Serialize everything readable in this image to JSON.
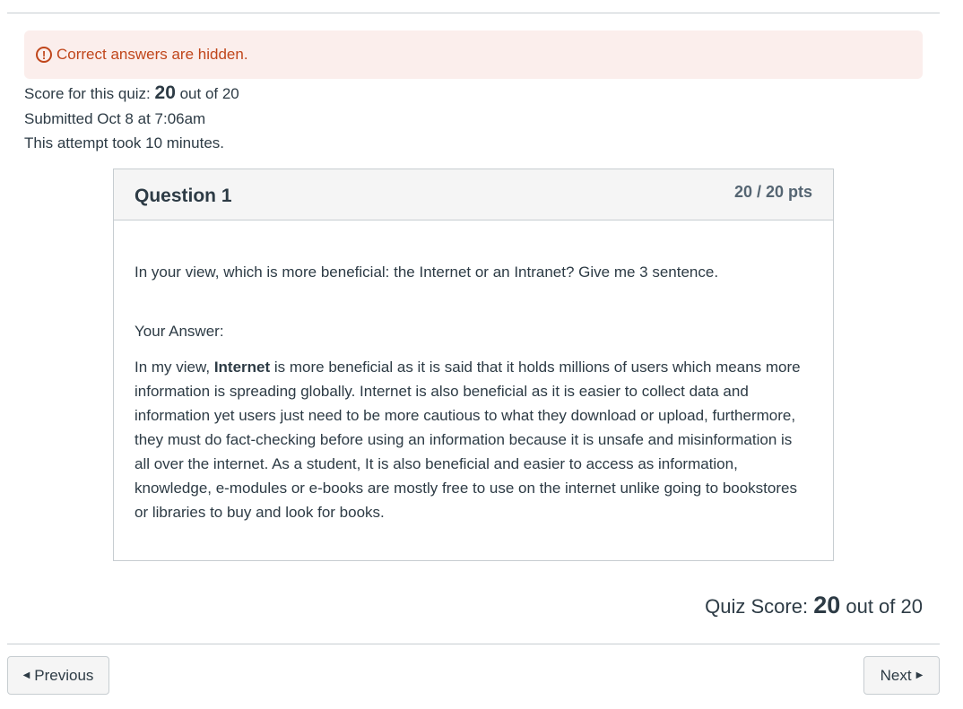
{
  "alert": {
    "icon": "exclamation-circle-icon",
    "text": "Correct answers are hidden."
  },
  "summary": {
    "score_prefix": "Score for this quiz: ",
    "score_value": "20",
    "score_suffix": " out of 20",
    "submitted": "Submitted Oct 8 at 7:06am",
    "duration": "This attempt took 10 minutes."
  },
  "question": {
    "title": "Question 1",
    "points": "20 / 20 pts",
    "prompt": "In your view, which is more beneficial: the Internet or an Intranet? Give me 3 sentence.",
    "answer_label": "Your Answer:",
    "answer_prefix": "In my view, ",
    "answer_bold": "Internet",
    "answer_rest": " is more beneficial as it is said that it holds millions of users which means more information is spreading globally. Internet is also beneficial as it is easier to collect data and information yet users just need to be more cautious to what they download or upload, furthermore, they must do fact-checking before using an information because it is unsafe and misinformation is all over the internet. As a student, It is also beneficial and easier to access as information, knowledge, e-modules or e-books are mostly free to use on the internet unlike going to bookstores or libraries to buy and look for books."
  },
  "quiz_score": {
    "prefix": "Quiz Score: ",
    "value": "20",
    "suffix": " out of 20"
  },
  "nav": {
    "previous_label": "Previous",
    "next_label": "Next",
    "previous_icon": "triangle-left-icon",
    "next_icon": "triangle-right-icon"
  },
  "colors": {
    "alert_bg": "#fbeeec",
    "alert_text": "#c0461b",
    "text": "#2d3b45"
  }
}
